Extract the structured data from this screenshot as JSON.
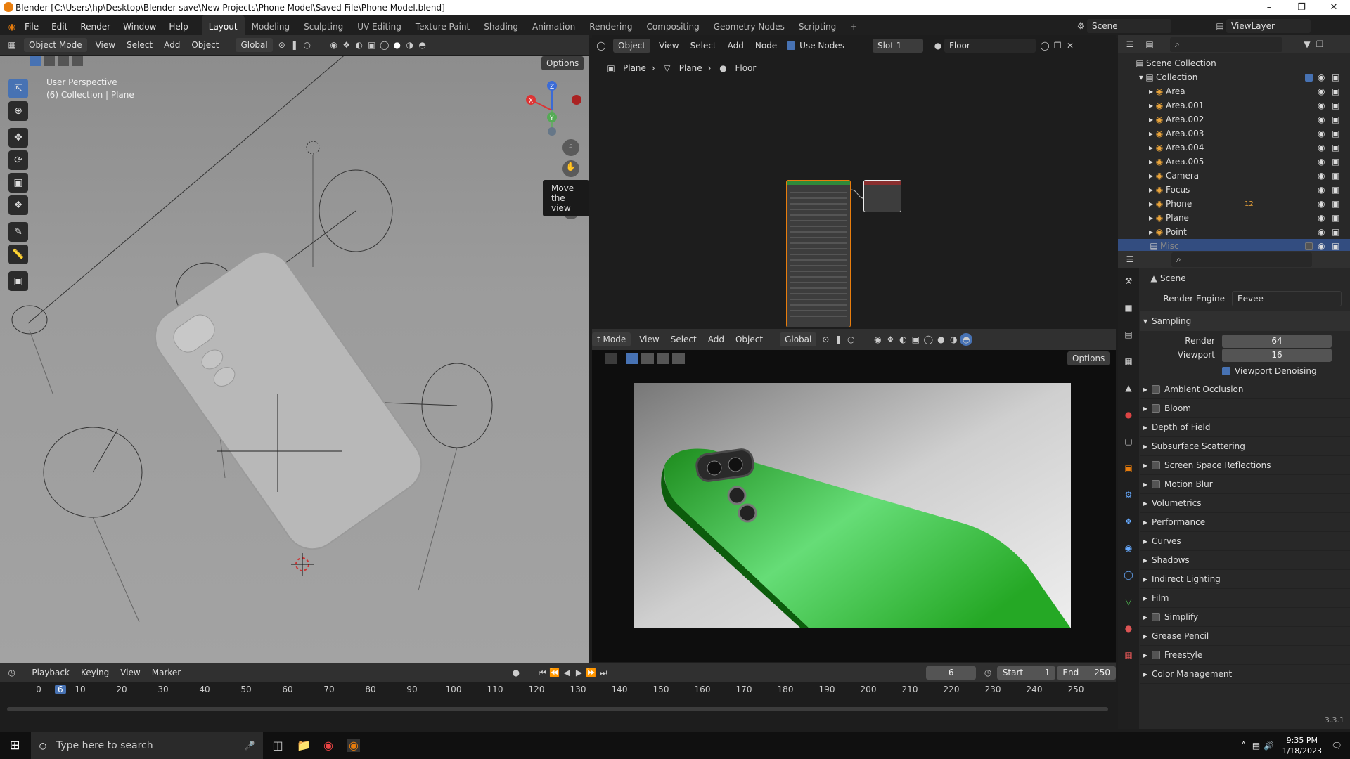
{
  "window": {
    "title": "Blender [C:\\Users\\hp\\Desktop\\Blender save\\New Projects\\Phone Model\\Saved File\\Phone Model.blend]"
  },
  "topmenu": {
    "items": [
      "File",
      "Edit",
      "Render",
      "Window",
      "Help"
    ]
  },
  "workspaces": [
    "Layout",
    "Modeling",
    "Sculpting",
    "UV Editing",
    "Texture Paint",
    "Shading",
    "Animation",
    "Rendering",
    "Compositing",
    "Geometry Nodes",
    "Scripting"
  ],
  "scene": {
    "name": "Scene",
    "viewlayer": "ViewLayer"
  },
  "viewport": {
    "mode": "Object Mode",
    "menus": [
      "View",
      "Select",
      "Add",
      "Object"
    ],
    "orientation": "Global",
    "options": "Options",
    "perspective": "User Perspective",
    "collection": "(6) Collection | Plane",
    "tooltip": "Move the view"
  },
  "node_editor": {
    "object_type": "Object",
    "menus": [
      "View",
      "Select",
      "Add",
      "Node"
    ],
    "use_nodes": "Use Nodes",
    "slot": "Slot 1",
    "material": "Floor",
    "breadcrumb": [
      "Plane",
      "Plane",
      "Floor"
    ]
  },
  "render_view": {
    "mode": "t Mode",
    "menus": [
      "View",
      "Select",
      "Add",
      "Object"
    ],
    "orientation": "Global",
    "options": "Options"
  },
  "outliner": {
    "root": "Scene Collection",
    "collection": "Collection",
    "items": [
      "Area",
      "Area.001",
      "Area.002",
      "Area.003",
      "Area.004",
      "Area.005",
      "Camera",
      "Focus",
      "Phone",
      "Plane",
      "Point"
    ],
    "misc": "Misc",
    "phone_badge": "12"
  },
  "properties": {
    "scene_label": "Scene",
    "render_engine_label": "Render Engine",
    "render_engine": "Eevee",
    "sampling": "Sampling",
    "render_label": "Render",
    "render_value": "64",
    "viewport_label": "Viewport",
    "viewport_value": "16",
    "denoise": "Viewport Denoising",
    "panels": [
      {
        "label": "Ambient Occlusion",
        "check": true
      },
      {
        "label": "Bloom",
        "check": true
      },
      {
        "label": "Depth of Field",
        "check": false
      },
      {
        "label": "Subsurface Scattering",
        "check": false
      },
      {
        "label": "Screen Space Reflections",
        "check": true
      },
      {
        "label": "Motion Blur",
        "check": true
      },
      {
        "label": "Volumetrics",
        "check": false
      },
      {
        "label": "Performance",
        "check": false
      },
      {
        "label": "Curves",
        "check": false
      },
      {
        "label": "Shadows",
        "check": false
      },
      {
        "label": "Indirect Lighting",
        "check": false
      },
      {
        "label": "Film",
        "check": false
      },
      {
        "label": "Simplify",
        "check": true
      },
      {
        "label": "Grease Pencil",
        "check": false
      },
      {
        "label": "Freestyle",
        "check": true
      },
      {
        "label": "Color Management",
        "check": false
      }
    ],
    "version": "3.3.1"
  },
  "timeline": {
    "menus": [
      "Playback",
      "Keying",
      "View",
      "Marker"
    ],
    "current_frame": "6",
    "start_label": "Start",
    "start": "1",
    "end_label": "End",
    "end": "250",
    "ticks": [
      "0",
      "10",
      "20",
      "30",
      "40",
      "50",
      "60",
      "70",
      "80",
      "90",
      "100",
      "110",
      "120",
      "130",
      "140",
      "150",
      "160",
      "170",
      "180",
      "190",
      "200",
      "210",
      "220",
      "230",
      "240",
      "250"
    ],
    "marker": "6"
  },
  "taskbar": {
    "search_placeholder": "Type here to search",
    "time": "9:35 PM",
    "date": "1/18/2023"
  },
  "colors": {
    "accent": "#4772b3",
    "phone_green": "#2fbf2f",
    "header": "#303030"
  }
}
